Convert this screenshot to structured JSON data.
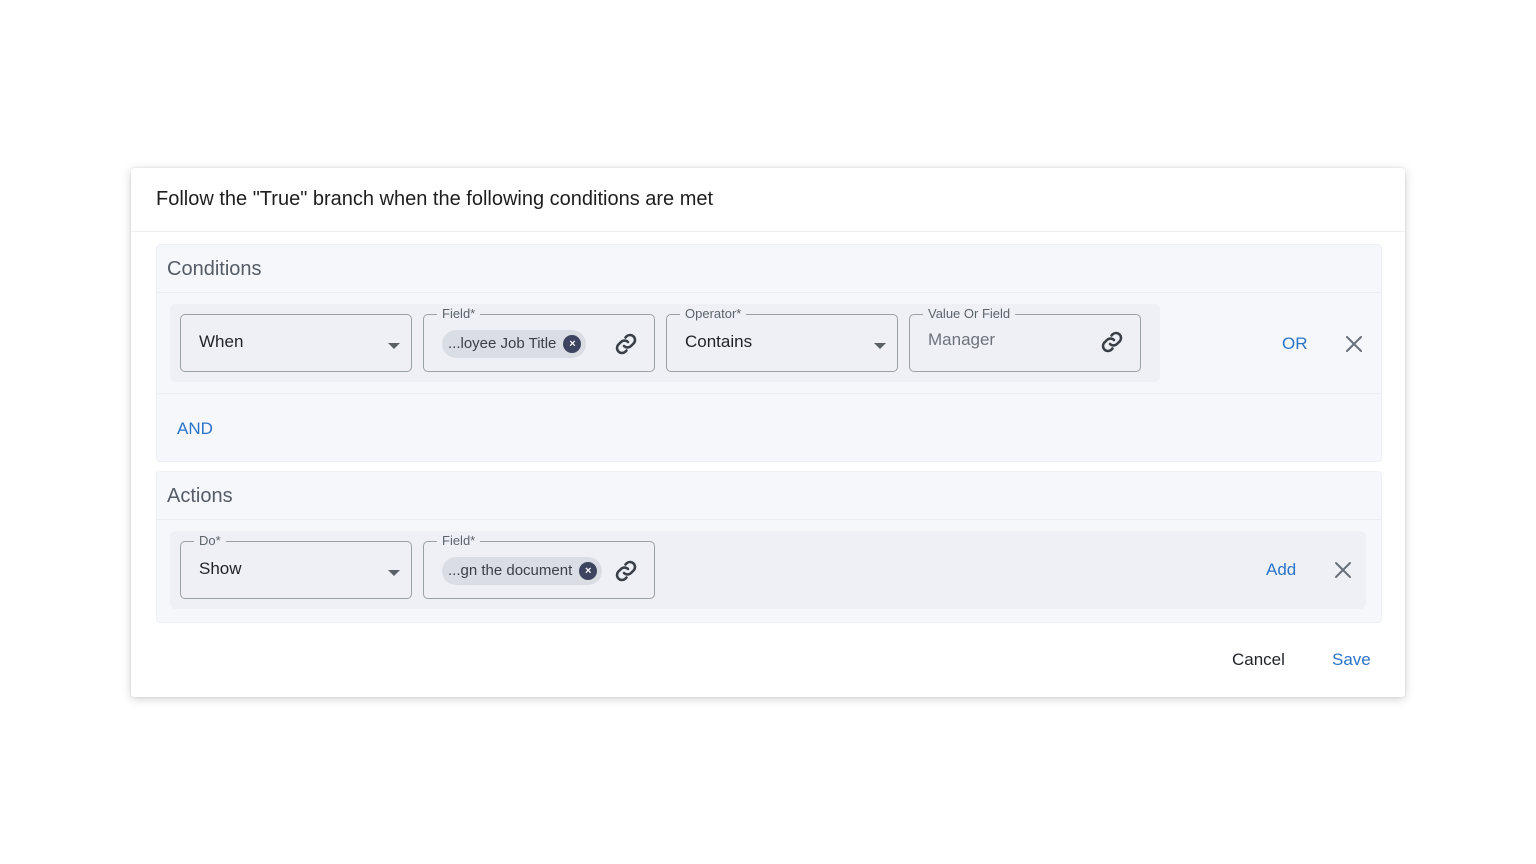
{
  "dialog": {
    "title": "Follow the \"True\" branch when the following conditions are met"
  },
  "conditions": {
    "title": "Conditions",
    "when": {
      "value": "When"
    },
    "field": {
      "legend": "Field*",
      "chip": "...loyee Job Title"
    },
    "operator": {
      "legend": "Operator*",
      "value": "Contains"
    },
    "value_field": {
      "legend": "Value Or Field",
      "value": "Manager"
    },
    "or_label": "OR",
    "and_label": "AND"
  },
  "actions": {
    "title": "Actions",
    "do": {
      "legend": "Do*",
      "value": "Show"
    },
    "field": {
      "legend": "Field*",
      "chip": "...gn the document"
    },
    "add_label": "Add"
  },
  "footer": {
    "cancel_label": "Cancel",
    "save_label": "Save"
  },
  "colors": {
    "accent": "#2a74c9",
    "chip_remove": "#3d4460"
  }
}
